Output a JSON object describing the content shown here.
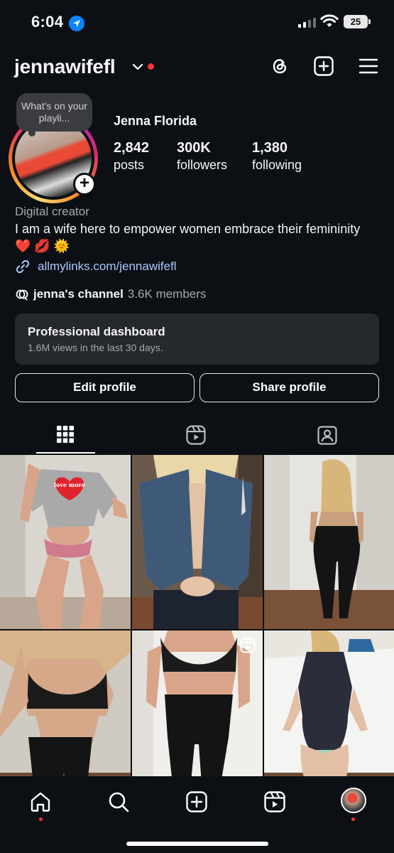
{
  "status_bar": {
    "time": "6:04",
    "battery": "25"
  },
  "header": {
    "username": "jennawifefl"
  },
  "profile": {
    "note": "What's on your playli...",
    "full_name": "Jenna Florida",
    "stats": [
      {
        "value": "2,842",
        "label": "posts"
      },
      {
        "value": "300K",
        "label": "followers"
      },
      {
        "value": "1,380",
        "label": "following"
      }
    ],
    "category": "Digital creator",
    "bio": "I am a wife here to empower women embrace their femininity",
    "bio_emojis": "❤️ 💋 🌞",
    "link": "allmylinks.com/jennawifefl",
    "channel_name": "jenna's channel",
    "channel_members": "3.6K members"
  },
  "dashboard": {
    "title": "Professional dashboard",
    "subtitle": "1.6M views in the last 30 days."
  },
  "buttons": {
    "edit": "Edit profile",
    "share": "Share profile"
  },
  "tabs": [
    {
      "icon": "grid-icon",
      "active": true
    },
    {
      "icon": "reels-icon",
      "active": false
    },
    {
      "icon": "tagged-icon",
      "active": false
    }
  ],
  "grid_tiles": [
    {
      "id": "post-1",
      "caption_text": "love more",
      "is_reel": false
    },
    {
      "id": "post-2",
      "is_reel": false
    },
    {
      "id": "post-3",
      "is_reel": false
    },
    {
      "id": "post-4",
      "is_reel": false
    },
    {
      "id": "post-5",
      "is_reel": true
    },
    {
      "id": "post-6",
      "is_reel": false
    }
  ],
  "bottom_nav": [
    "home-icon",
    "search-icon",
    "create-icon",
    "reels-icon",
    "profile-avatar"
  ],
  "colors": {
    "background": "#0c1014",
    "link": "#a9c8ff",
    "notification": "#ff3040",
    "card": "#25282c"
  }
}
